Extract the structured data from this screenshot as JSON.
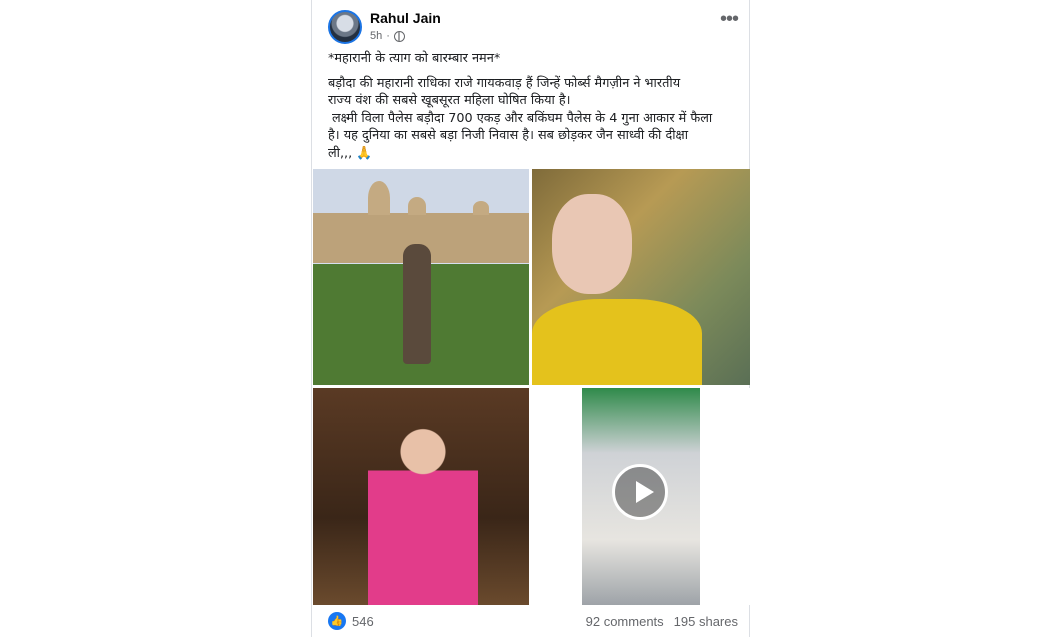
{
  "post": {
    "author": "Rahul Jain",
    "time": "5h",
    "privacy_icon": "globe-icon",
    "more_icon": "more-options-icon",
    "body": {
      "line1": "*महारानी के त्याग को बारम्बार नमन*",
      "line2": "बड़ौदा की महारानी राधिका राजे गायकवाड़ हैं जिन्हें फोर्ब्स मैगज़ीन ने भारतीय",
      "line3": "राज्य वंश की सबसे खूबसूरत महिला घोषित किया है।",
      "line4": "लक्ष्मी विला पैलेस बड़ौदा 700 एकड़ और बकिंघम पैलेस के 4 गुना आकार में फैला",
      "line5": "है।  यह दुनिया का सबसे बड़ा निजी निवास है। सब छोड़कर जैन साध्वी की दीक्षा",
      "line6": "ली,,, 🙏"
    },
    "media": {
      "play_icon": "play-icon"
    },
    "stats": {
      "like_icon": "like-icon",
      "likes": "546",
      "comments": "92 comments",
      "shares": "195 shares"
    }
  },
  "colors": {
    "like_blue": "#1877f2",
    "text": "#1c1e21",
    "secondary": "#65676b"
  }
}
